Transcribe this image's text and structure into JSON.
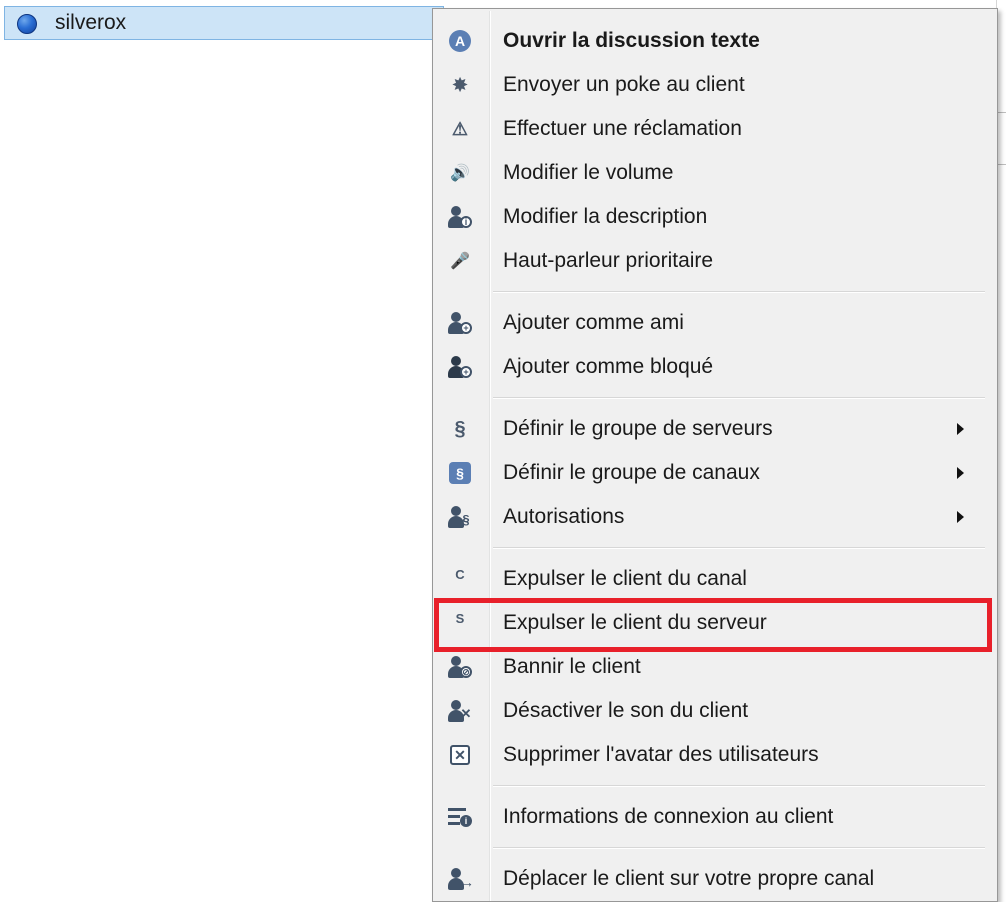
{
  "tree": {
    "client_name": "silverox"
  },
  "menu": {
    "items": [
      {
        "label": "Ouvrir la discussion texte",
        "bold": true,
        "icon": "chat-bubble-icon",
        "glyph": "A",
        "submenu": false
      },
      {
        "label": "Envoyer un poke au client",
        "icon": "poke-icon",
        "glyph": "✸",
        "submenu": false
      },
      {
        "label": "Effectuer une réclamation",
        "icon": "complaint-icon",
        "glyph": "⚠",
        "submenu": false
      },
      {
        "label": "Modifier le volume",
        "icon": "volume-icon",
        "glyph": "🔊",
        "submenu": false
      },
      {
        "label": "Modifier la description",
        "icon": "user-info-icon",
        "glyph": "i",
        "submenu": false
      },
      {
        "label": "Haut-parleur prioritaire",
        "icon": "microphone-icon",
        "glyph": "🎤",
        "submenu": false
      },
      {
        "label": "Ajouter comme ami",
        "icon": "add-friend-icon",
        "glyph": "+",
        "submenu": false
      },
      {
        "label": "Ajouter comme bloqué",
        "icon": "add-blocked-icon",
        "glyph": "+",
        "submenu": false
      },
      {
        "label": "Définir le groupe de serveurs",
        "icon": "server-group-icon",
        "glyph": "§",
        "submenu": true
      },
      {
        "label": "Définir le groupe de canaux",
        "icon": "channel-group-icon",
        "glyph": "§",
        "submenu": true
      },
      {
        "label": "Autorisations",
        "icon": "permissions-icon",
        "glyph": "§",
        "submenu": true
      },
      {
        "label": "Expulser le client du canal",
        "icon": "kick-channel-icon",
        "glyph": "C",
        "submenu": false
      },
      {
        "label": "Expulser le client du serveur",
        "icon": "kick-server-icon",
        "glyph": "S",
        "submenu": false
      },
      {
        "label": "Bannir le client",
        "icon": "ban-icon",
        "glyph": "⊘",
        "submenu": false
      },
      {
        "label": "Désactiver le son du client",
        "icon": "mute-client-icon",
        "glyph": "✕",
        "submenu": false
      },
      {
        "label": "Supprimer l'avatar des utilisateurs",
        "icon": "delete-avatar-icon",
        "glyph": "✕",
        "submenu": false
      },
      {
        "label": "Informations de connexion au client",
        "icon": "connection-info-icon",
        "glyph": "i",
        "submenu": false
      },
      {
        "label": "Déplacer le client sur votre propre canal",
        "icon": "move-client-icon",
        "glyph": "→",
        "submenu": false
      }
    ]
  },
  "highlight": {
    "target": "Expulser le client du serveur",
    "color": "#e8202a"
  }
}
